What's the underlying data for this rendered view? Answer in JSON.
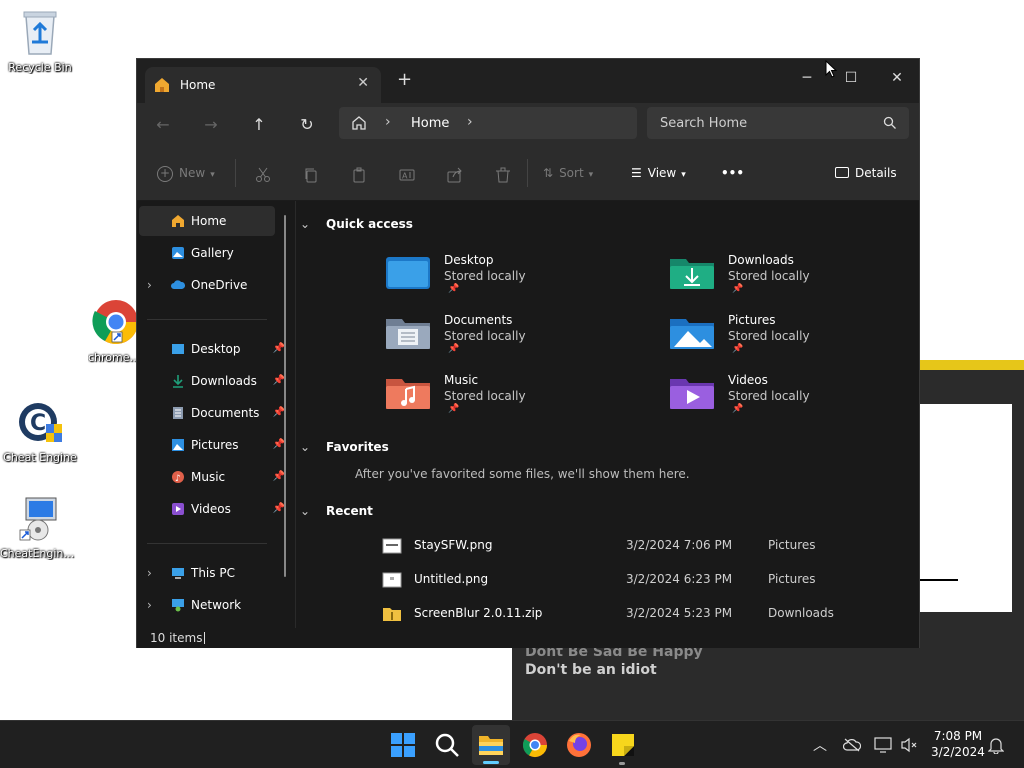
{
  "desktop": {
    "icons": [
      {
        "label": "Recycle Bin"
      },
      {
        "label": "chrome.exe"
      },
      {
        "label": "Cheat Engine"
      },
      {
        "label": "CheatEngine..."
      }
    ]
  },
  "background_window": {
    "line1": "Dont Be Sad Be Happy",
    "line2": "Don't be an idiot"
  },
  "explorer": {
    "tab_title": "Home",
    "tab_close": "✕",
    "new_tab": "+",
    "window_controls": {
      "minimize": "─",
      "maximize": "☐",
      "close": "✕"
    },
    "nav": {
      "back": "←",
      "forward": "→",
      "up": "↑",
      "refresh": "↻"
    },
    "breadcrumb": {
      "location": "Home",
      "sep": "›"
    },
    "search_placeholder": "Search Home",
    "toolbar": {
      "new": "New",
      "sort": "Sort",
      "view": "View",
      "more": "•••",
      "details": "Details"
    },
    "sidebar": {
      "home": "Home",
      "gallery": "Gallery",
      "onedrive": "OneDrive",
      "desktop": "Desktop",
      "downloads": "Downloads",
      "documents": "Documents",
      "pictures": "Pictures",
      "music": "Music",
      "videos": "Videos",
      "thispc": "This PC",
      "network": "Network"
    },
    "sections": {
      "quick_access": "Quick access",
      "favorites": "Favorites",
      "favorites_empty": "After you've favorited some files, we'll show them here.",
      "recent": "Recent"
    },
    "quick_access": [
      {
        "name": "Desktop",
        "sub": "Stored locally",
        "color": "#3aa0e8"
      },
      {
        "name": "Downloads",
        "sub": "Stored locally",
        "color": "#1f9f7a"
      },
      {
        "name": "Documents",
        "sub": "Stored locally",
        "color": "#8c9bb0"
      },
      {
        "name": "Pictures",
        "sub": "Stored locally",
        "color": "#2d8fe0"
      },
      {
        "name": "Music",
        "sub": "Stored locally",
        "color": "#e0604a"
      },
      {
        "name": "Videos",
        "sub": "Stored locally",
        "color": "#8a4fd0"
      }
    ],
    "recent": [
      {
        "name": "StaySFW.png",
        "date": "3/2/2024 7:06 PM",
        "location": "Pictures"
      },
      {
        "name": "Untitled.png",
        "date": "3/2/2024 6:23 PM",
        "location": "Pictures"
      },
      {
        "name": "ScreenBlur 2.0.11.zip",
        "date": "3/2/2024 5:23 PM",
        "location": "Downloads"
      }
    ],
    "status": "10 items"
  },
  "taskbar": {
    "clock_time": "7:08 PM",
    "clock_date": "3/2/2024"
  }
}
